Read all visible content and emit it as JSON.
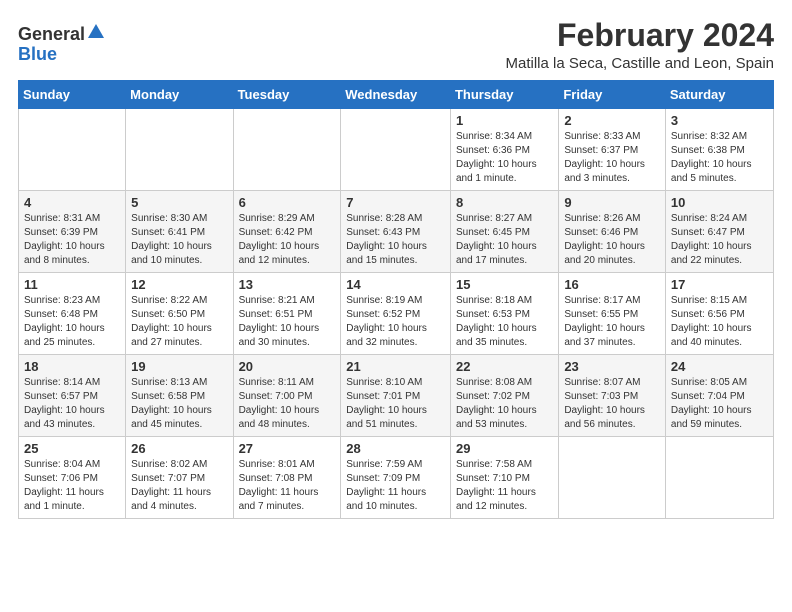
{
  "logo": {
    "general": "General",
    "blue": "Blue"
  },
  "title": "February 2024",
  "subtitle": "Matilla la Seca, Castille and Leon, Spain",
  "headers": [
    "Sunday",
    "Monday",
    "Tuesday",
    "Wednesday",
    "Thursday",
    "Friday",
    "Saturday"
  ],
  "weeks": [
    [
      {
        "num": "",
        "info": ""
      },
      {
        "num": "",
        "info": ""
      },
      {
        "num": "",
        "info": ""
      },
      {
        "num": "",
        "info": ""
      },
      {
        "num": "1",
        "info": "Sunrise: 8:34 AM\nSunset: 6:36 PM\nDaylight: 10 hours and 1 minute."
      },
      {
        "num": "2",
        "info": "Sunrise: 8:33 AM\nSunset: 6:37 PM\nDaylight: 10 hours and 3 minutes."
      },
      {
        "num": "3",
        "info": "Sunrise: 8:32 AM\nSunset: 6:38 PM\nDaylight: 10 hours and 5 minutes."
      }
    ],
    [
      {
        "num": "4",
        "info": "Sunrise: 8:31 AM\nSunset: 6:39 PM\nDaylight: 10 hours and 8 minutes."
      },
      {
        "num": "5",
        "info": "Sunrise: 8:30 AM\nSunset: 6:41 PM\nDaylight: 10 hours and 10 minutes."
      },
      {
        "num": "6",
        "info": "Sunrise: 8:29 AM\nSunset: 6:42 PM\nDaylight: 10 hours and 12 minutes."
      },
      {
        "num": "7",
        "info": "Sunrise: 8:28 AM\nSunset: 6:43 PM\nDaylight: 10 hours and 15 minutes."
      },
      {
        "num": "8",
        "info": "Sunrise: 8:27 AM\nSunset: 6:45 PM\nDaylight: 10 hours and 17 minutes."
      },
      {
        "num": "9",
        "info": "Sunrise: 8:26 AM\nSunset: 6:46 PM\nDaylight: 10 hours and 20 minutes."
      },
      {
        "num": "10",
        "info": "Sunrise: 8:24 AM\nSunset: 6:47 PM\nDaylight: 10 hours and 22 minutes."
      }
    ],
    [
      {
        "num": "11",
        "info": "Sunrise: 8:23 AM\nSunset: 6:48 PM\nDaylight: 10 hours and 25 minutes."
      },
      {
        "num": "12",
        "info": "Sunrise: 8:22 AM\nSunset: 6:50 PM\nDaylight: 10 hours and 27 minutes."
      },
      {
        "num": "13",
        "info": "Sunrise: 8:21 AM\nSunset: 6:51 PM\nDaylight: 10 hours and 30 minutes."
      },
      {
        "num": "14",
        "info": "Sunrise: 8:19 AM\nSunset: 6:52 PM\nDaylight: 10 hours and 32 minutes."
      },
      {
        "num": "15",
        "info": "Sunrise: 8:18 AM\nSunset: 6:53 PM\nDaylight: 10 hours and 35 minutes."
      },
      {
        "num": "16",
        "info": "Sunrise: 8:17 AM\nSunset: 6:55 PM\nDaylight: 10 hours and 37 minutes."
      },
      {
        "num": "17",
        "info": "Sunrise: 8:15 AM\nSunset: 6:56 PM\nDaylight: 10 hours and 40 minutes."
      }
    ],
    [
      {
        "num": "18",
        "info": "Sunrise: 8:14 AM\nSunset: 6:57 PM\nDaylight: 10 hours and 43 minutes."
      },
      {
        "num": "19",
        "info": "Sunrise: 8:13 AM\nSunset: 6:58 PM\nDaylight: 10 hours and 45 minutes."
      },
      {
        "num": "20",
        "info": "Sunrise: 8:11 AM\nSunset: 7:00 PM\nDaylight: 10 hours and 48 minutes."
      },
      {
        "num": "21",
        "info": "Sunrise: 8:10 AM\nSunset: 7:01 PM\nDaylight: 10 hours and 51 minutes."
      },
      {
        "num": "22",
        "info": "Sunrise: 8:08 AM\nSunset: 7:02 PM\nDaylight: 10 hours and 53 minutes."
      },
      {
        "num": "23",
        "info": "Sunrise: 8:07 AM\nSunset: 7:03 PM\nDaylight: 10 hours and 56 minutes."
      },
      {
        "num": "24",
        "info": "Sunrise: 8:05 AM\nSunset: 7:04 PM\nDaylight: 10 hours and 59 minutes."
      }
    ],
    [
      {
        "num": "25",
        "info": "Sunrise: 8:04 AM\nSunset: 7:06 PM\nDaylight: 11 hours and 1 minute."
      },
      {
        "num": "26",
        "info": "Sunrise: 8:02 AM\nSunset: 7:07 PM\nDaylight: 11 hours and 4 minutes."
      },
      {
        "num": "27",
        "info": "Sunrise: 8:01 AM\nSunset: 7:08 PM\nDaylight: 11 hours and 7 minutes."
      },
      {
        "num": "28",
        "info": "Sunrise: 7:59 AM\nSunset: 7:09 PM\nDaylight: 11 hours and 10 minutes."
      },
      {
        "num": "29",
        "info": "Sunrise: 7:58 AM\nSunset: 7:10 PM\nDaylight: 11 hours and 12 minutes."
      },
      {
        "num": "",
        "info": ""
      },
      {
        "num": "",
        "info": ""
      }
    ]
  ]
}
